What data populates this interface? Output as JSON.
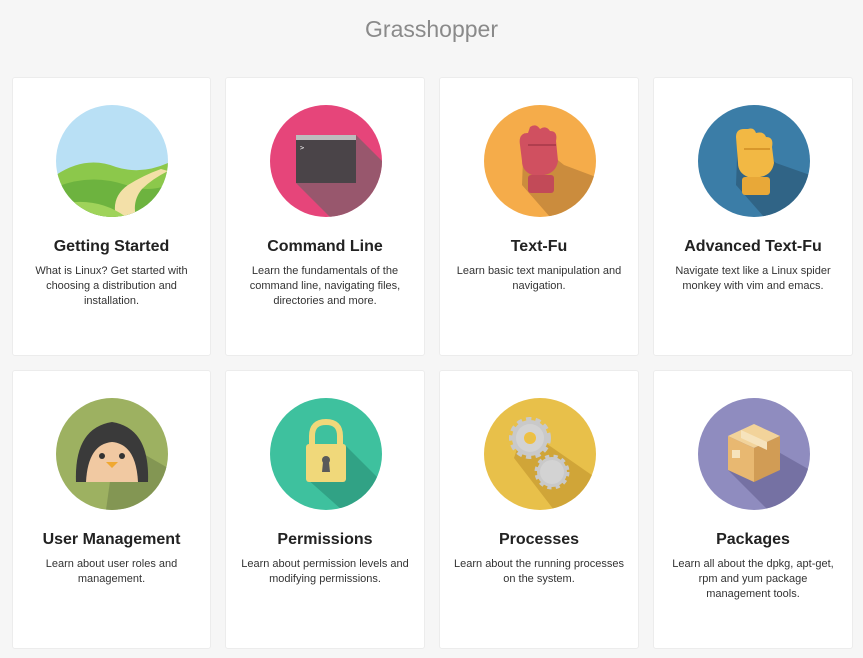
{
  "header": {
    "title": "Grasshopper"
  },
  "cards": [
    {
      "title": "Getting Started",
      "description": "What is Linux? Get started with choosing a distribution and installation.",
      "icon": "landscape-icon",
      "color": "#b9e0f5"
    },
    {
      "title": "Command Line",
      "description": "Learn the fundamentals of the command line, navigating files, directories and more.",
      "icon": "terminal-icon",
      "color": "#e6457a"
    },
    {
      "title": "Text-Fu",
      "description": "Learn basic text manipulation and navigation.",
      "icon": "red-glove-icon",
      "color": "#f5ac4a"
    },
    {
      "title": "Advanced Text-Fu",
      "description": "Navigate text like a Linux spider monkey with vim and emacs.",
      "icon": "yellow-glove-icon",
      "color": "#3b7da7"
    },
    {
      "title": "User Management",
      "description": "Learn about user roles and management.",
      "icon": "penguin-icon",
      "color": "#9db161"
    },
    {
      "title": "Permissions",
      "description": "Learn about permission levels and modifying permissions.",
      "icon": "padlock-icon",
      "color": "#3ec19e"
    },
    {
      "title": "Processes",
      "description": "Learn about the running processes on the system.",
      "icon": "gears-icon",
      "color": "#e8c04a"
    },
    {
      "title": "Packages",
      "description": "Learn all about the dpkg, apt-get, rpm and yum package management tools.",
      "icon": "package-box-icon",
      "color": "#8f8cbf"
    }
  ]
}
